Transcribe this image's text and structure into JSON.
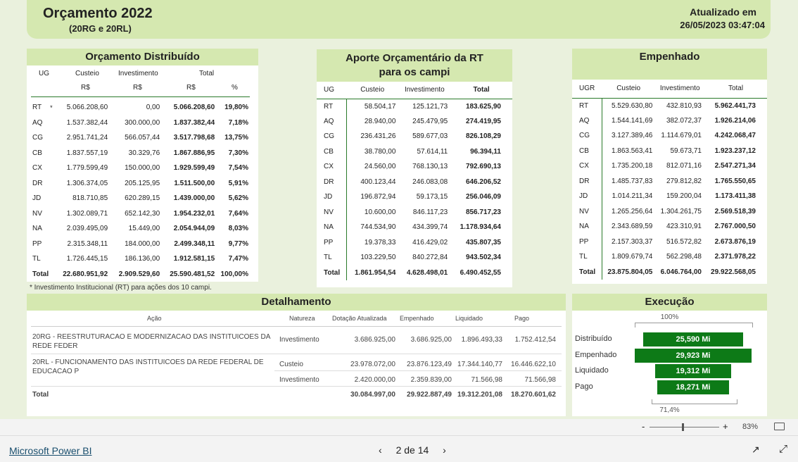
{
  "header": {
    "title": "Orçamento 2022",
    "subtitle": "(20RG e 20RL)",
    "updated_label": "Atualizado em",
    "updated_value": "26/05/2023 03:47:04"
  },
  "distribuido": {
    "title": "Orçamento Distribuído",
    "cols": [
      "UG",
      "Custeio",
      "Investimento",
      "Total"
    ],
    "subcols": [
      "R$",
      "R$",
      "R$",
      "%"
    ],
    "rows": [
      [
        "RT",
        "*",
        "5.066.208,60",
        "0,00",
        "5.066.208,60",
        "19,80%"
      ],
      [
        "AQ",
        "",
        "1.537.382,44",
        "300.000,00",
        "1.837.382,44",
        "7,18%"
      ],
      [
        "CG",
        "",
        "2.951.741,24",
        "566.057,44",
        "3.517.798,68",
        "13,75%"
      ],
      [
        "CB",
        "",
        "1.837.557,19",
        "30.329,76",
        "1.867.886,95",
        "7,30%"
      ],
      [
        "CX",
        "",
        "1.779.599,49",
        "150.000,00",
        "1.929.599,49",
        "7,54%"
      ],
      [
        "DR",
        "",
        "1.306.374,05",
        "205.125,95",
        "1.511.500,00",
        "5,91%"
      ],
      [
        "JD",
        "",
        "818.710,85",
        "620.289,15",
        "1.439.000,00",
        "5,62%"
      ],
      [
        "NV",
        "",
        "1.302.089,71",
        "652.142,30",
        "1.954.232,01",
        "7,64%"
      ],
      [
        "NA",
        "",
        "2.039.495,09",
        "15.449,00",
        "2.054.944,09",
        "8,03%"
      ],
      [
        "PP",
        "",
        "2.315.348,11",
        "184.000,00",
        "2.499.348,11",
        "9,77%"
      ],
      [
        "TL",
        "",
        "1.726.445,15",
        "186.136,00",
        "1.912.581,15",
        "7,47%"
      ]
    ],
    "total": [
      "Total",
      "",
      "22.680.951,92",
      "2.909.529,60",
      "25.590.481,52",
      "100,00%"
    ]
  },
  "note": "* Investimento Institucional (RT) para ações dos 10 campi.",
  "aporte": {
    "title": "Aporte Orçamentário da RT para os campi",
    "cols": [
      "UG",
      "Custeio",
      "Investimento",
      "Total"
    ],
    "rows": [
      [
        "RT",
        "58.504,17",
        "125.121,73",
        "183.625,90"
      ],
      [
        "AQ",
        "28.940,00",
        "245.479,95",
        "274.419,95"
      ],
      [
        "CG",
        "236.431,26",
        "589.677,03",
        "826.108,29"
      ],
      [
        "CB",
        "38.780,00",
        "57.614,11",
        "96.394,11"
      ],
      [
        "CX",
        "24.560,00",
        "768.130,13",
        "792.690,13"
      ],
      [
        "DR",
        "400.123,44",
        "246.083,08",
        "646.206,52"
      ],
      [
        "JD",
        "196.872,94",
        "59.173,15",
        "256.046,09"
      ],
      [
        "NV",
        "10.600,00",
        "846.117,23",
        "856.717,23"
      ],
      [
        "NA",
        "744.534,90",
        "434.399,74",
        "1.178.934,64"
      ],
      [
        "PP",
        "19.378,33",
        "416.429,02",
        "435.807,35"
      ],
      [
        "TL",
        "103.229,50",
        "840.272,84",
        "943.502,34"
      ]
    ],
    "total": [
      "Total",
      "1.861.954,54",
      "4.628.498,01",
      "6.490.452,55"
    ]
  },
  "empenhado": {
    "title": "Empenhado",
    "cols": [
      "UGR",
      "Custeio",
      "Investimento",
      "Total"
    ],
    "rows": [
      [
        "RT",
        "5.529.630,80",
        "432.810,93",
        "5.962.441,73"
      ],
      [
        "AQ",
        "1.544.141,69",
        "382.072,37",
        "1.926.214,06"
      ],
      [
        "CG",
        "3.127.389,46",
        "1.114.679,01",
        "4.242.068,47"
      ],
      [
        "CB",
        "1.863.563,41",
        "59.673,71",
        "1.923.237,12"
      ],
      [
        "CX",
        "1.735.200,18",
        "812.071,16",
        "2.547.271,34"
      ],
      [
        "DR",
        "1.485.737,83",
        "279.812,82",
        "1.765.550,65"
      ],
      [
        "JD",
        "1.014.211,34",
        "159.200,04",
        "1.173.411,38"
      ],
      [
        "NV",
        "1.265.256,64",
        "1.304.261,75",
        "2.569.518,39"
      ],
      [
        "NA",
        "2.343.689,59",
        "423.310,91",
        "2.767.000,50"
      ],
      [
        "PP",
        "2.157.303,37",
        "516.572,82",
        "2.673.876,19"
      ],
      [
        "TL",
        "1.809.679,74",
        "562.298,48",
        "2.371.978,22"
      ]
    ],
    "total": [
      "Total",
      "23.875.804,05",
      "6.046.764,00",
      "29.922.568,05"
    ]
  },
  "detalhamento": {
    "title": "Detalhamento",
    "cols": [
      "Ação",
      "Natureza",
      "Dotação Atualizada",
      "Empenhado",
      "Liquidado",
      "Pago"
    ],
    "rows": [
      {
        "acao": "20RG - REESTRUTURACAO E MODERNIZACAO DAS INSTITUICOES DA REDE FEDER",
        "natureza": "Investimento",
        "dotacao": "3.686.925,00",
        "empenhado": "3.686.925,00",
        "liquidado": "1.896.493,33",
        "pago": "1.752.412,54"
      },
      {
        "acao": "20RL - FUNCIONAMENTO DAS INSTITUICOES DA REDE FEDERAL DE EDUCACAO P",
        "natureza": "Custeio",
        "dotacao": "23.978.072,00",
        "empenhado": "23.876.123,49",
        "liquidado": "17.344.140,77",
        "pago": "16.446.622,10"
      },
      {
        "acao": "",
        "natureza": "Investimento",
        "dotacao": "2.420.000,00",
        "empenhado": "2.359.839,00",
        "liquidado": "71.566,98",
        "pago": "71.566,98"
      }
    ],
    "total": {
      "label": "Total",
      "dotacao": "30.084.997,00",
      "empenhado": "29.922.887,49",
      "liquidado": "19.312.201,08",
      "pago": "18.270.601,62"
    }
  },
  "execucao": {
    "title": "Execução",
    "top_pct": "100%",
    "bottom_pct": "71,4%",
    "bars": [
      {
        "label": "Distribuído",
        "value": "25,590 Mi",
        "amount": 25.59
      },
      {
        "label": "Empenhado",
        "value": "29,923 Mi",
        "amount": 29.923
      },
      {
        "label": "Liquidado",
        "value": "19,312 Mi",
        "amount": 19.312
      },
      {
        "label": "Pago",
        "value": "18,271 Mi",
        "amount": 18.271
      }
    ],
    "bar_color": "#0d7a17"
  },
  "zoom": {
    "minus": "-",
    "plus": "+",
    "level": "83%",
    "level_fraction": 0.5
  },
  "footer": {
    "brand": "Microsoft Power BI",
    "page": "2 de 14"
  }
}
